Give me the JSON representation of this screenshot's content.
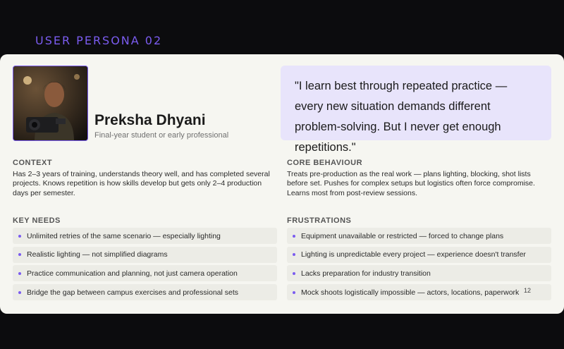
{
  "header": {
    "kicker": "USER PERSONA 02"
  },
  "persona": {
    "name": "Preksha Dhyani",
    "role": "Final-year student or early professional",
    "quote": "\"I learn best through repeated practice — every new situation demands different problem-solving. But I never get enough repetitions.\""
  },
  "context": {
    "title": "CONTEXT",
    "text": "Has 2–3 years of training, understands theory well, and has completed several projects. Knows repetition is how skills develop but gets only 2–4 production days per semester."
  },
  "core_behaviour": {
    "title": "CORE BEHAVIOUR",
    "text": "Treats pre-production as the real work — plans lighting, blocking, shot lists before set. Pushes for complex setups but logistics often force compromise. Learns most from post-review sessions."
  },
  "key_needs": {
    "title": "KEY NEEDS",
    "items": [
      "Unlimited retries of the same scenario — especially lighting",
      "Realistic lighting — not simplified diagrams",
      "Practice communication and planning, not just camera operation",
      "Bridge the gap between campus exercises and professional sets"
    ]
  },
  "frustrations": {
    "title": "FRUSTRATIONS",
    "items": [
      "Equipment unavailable or restricted — forced to change plans",
      "Lighting is unpredictable every project — experience doesn't transfer",
      "Lacks preparation for industry transition",
      "Mock shoots logistically impossible — actors, locations, paperwork"
    ]
  },
  "page_number": "12",
  "colors": {
    "accent": "#7b5cf0",
    "quote_bg": "#e8e4fb",
    "card_bg": "#f6f6f1"
  }
}
